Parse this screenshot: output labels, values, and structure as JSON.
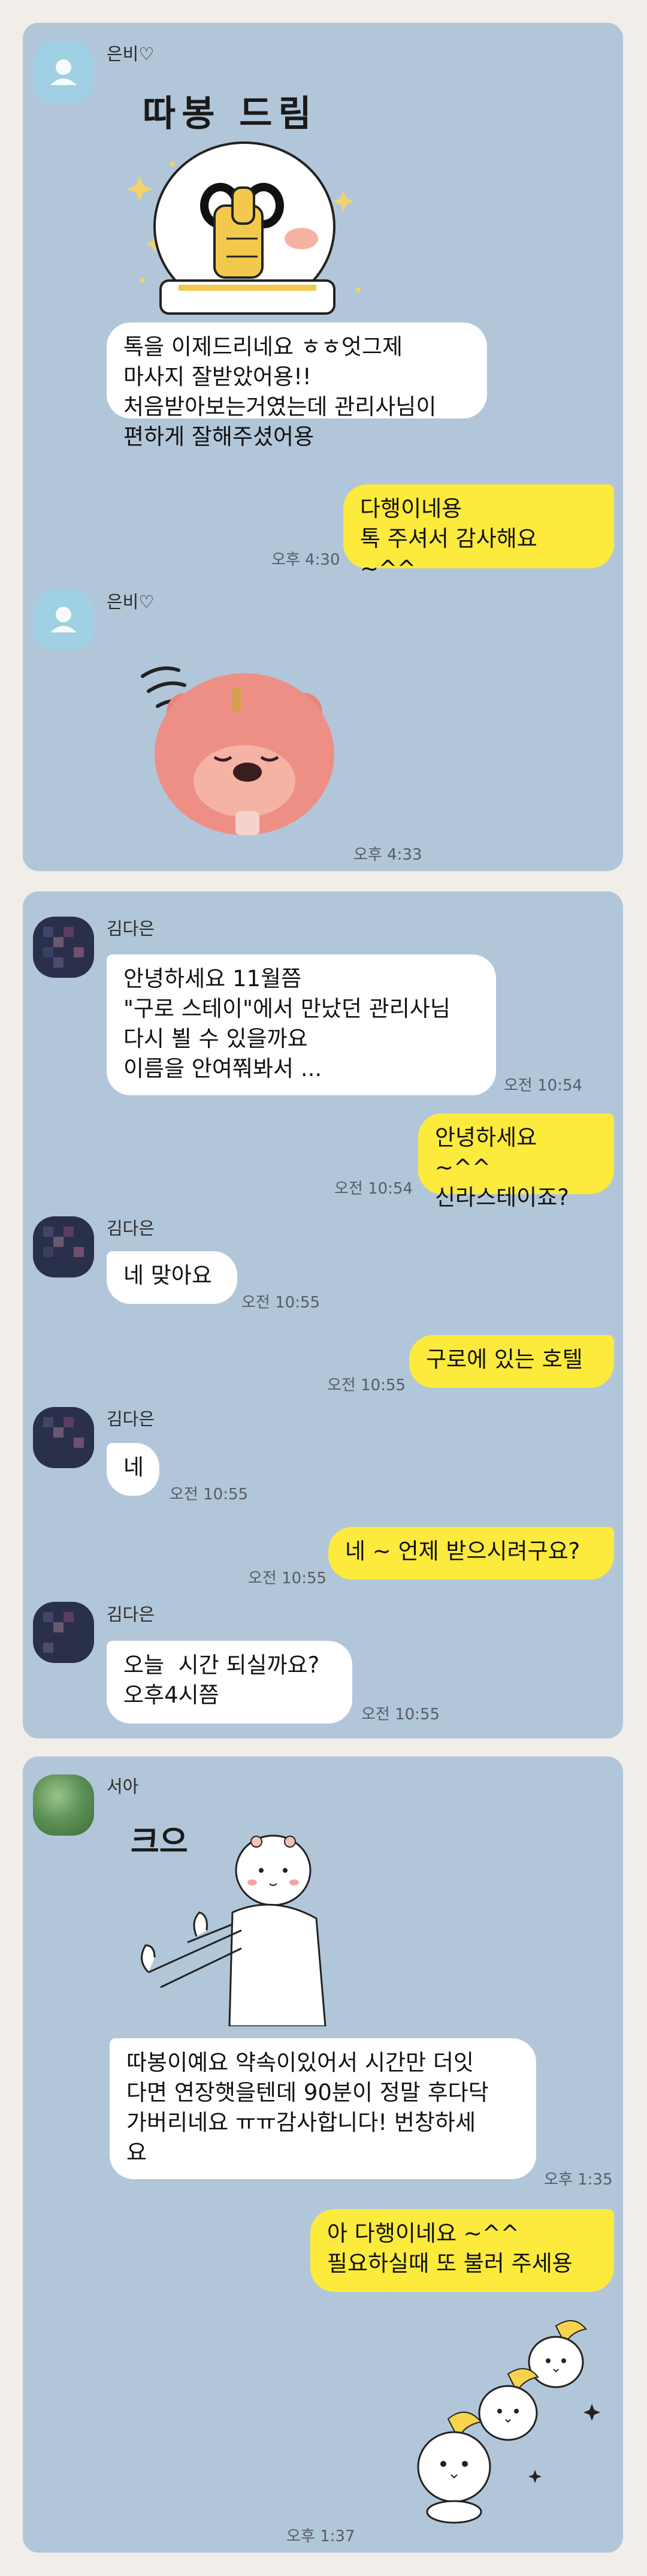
{
  "panels": [
    {
      "messages": {
        "s1_name": "은비♡",
        "s1_sticker_text": "따봉 드림",
        "s1_bubble": "톡을 이제드리네요 ㅎㅎ엇그제\n마사지 잘받았어용!!\n처음받아보는거였는데 관리사님이\n편하게 잘해주셨어용",
        "s1_reply": "다행이네용\n톡 주셔서 감사해요 ~^^",
        "s1_reply_time": "오후 4:30",
        "s1_name2": "은비♡",
        "s1_sticker2_time": "오후 4:33"
      }
    },
    {
      "messages": {
        "s2_name1": "김다은",
        "s2_b1": "안녕하세요 11월쯤\n\"구로 스테이\"에서 만났던 관리사님\n다시 뵐 수 있을까요\n이름을 안여쭤봐서 ...",
        "s2_b1_time": "오전 10:54",
        "s2_r1": "안녕하세요 ~^^\n신라스테이죠?",
        "s2_r1_time": "오전 10:54",
        "s2_name2": "김다은",
        "s2_b2": "네 맞아요",
        "s2_b2_time": "오전 10:55",
        "s2_r2": "구로에 있는 호텔",
        "s2_r2_time": "오전 10:55",
        "s2_name3": "김다은",
        "s2_b3": "네",
        "s2_b3_time": "오전 10:55",
        "s2_r3": "네 ~ 언제 받으시려구요?",
        "s2_r3_time": "오전 10:55",
        "s2_name4": "김다은",
        "s2_b4": "오늘  시간 되실까요?\n오후4시쯤",
        "s2_b4_time": "오전 10:55"
      }
    },
    {
      "messages": {
        "s3_name": "서아",
        "s3_sticker_text": "크으",
        "s3_bubble": "따봉이예요 약속이있어서 시간만 더잇\n다면 연장햇을텐데 90분이 정말 후다닥\n가버리네요 ㅠㅠ감사합니다! 번창하세\n요",
        "s3_bubble_time": "오후 1:35",
        "s3_reply": "아 다행이네요 ~^^\n필요하실때 또 불러 주세용",
        "s3_sticker_time": "오후 1:37"
      }
    }
  ],
  "colors": {
    "page_bg": "#f1ede8",
    "chat_bg": "#b2c6d9",
    "my_bubble": "#fcea3d",
    "their_bubble": "#ffffff"
  }
}
